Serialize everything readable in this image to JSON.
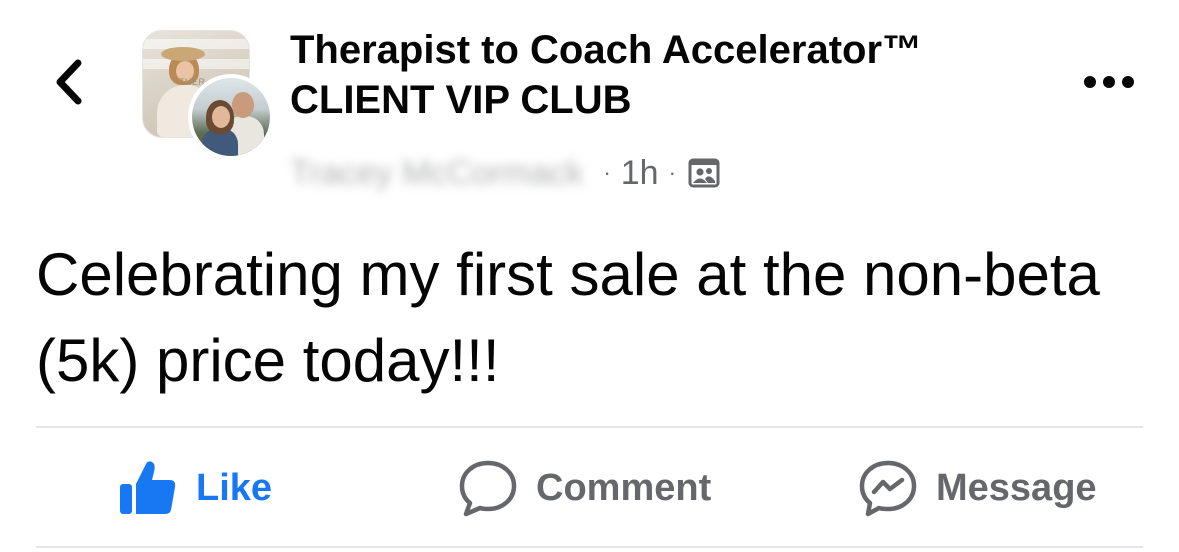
{
  "header": {
    "group_name": "Therapist to Coach Accelerator™ CLIENT VIP CLUB",
    "author_name": "Tracey McCormack",
    "separator": "·",
    "timestamp": "1h",
    "audience_icon": "group-members-icon",
    "back_icon": "chevron-left-icon",
    "more_icon": "more-dots-icon"
  },
  "post": {
    "text": "Celebrating my first sale at the non-beta (5k) price today!!!"
  },
  "actions": {
    "like_label": "Like",
    "comment_label": "Comment",
    "message_label": "Message"
  },
  "colors": {
    "accent": "#1877f2",
    "secondary_text": "#65676b",
    "primary_text": "#050505",
    "divider": "#e4e6eb"
  }
}
